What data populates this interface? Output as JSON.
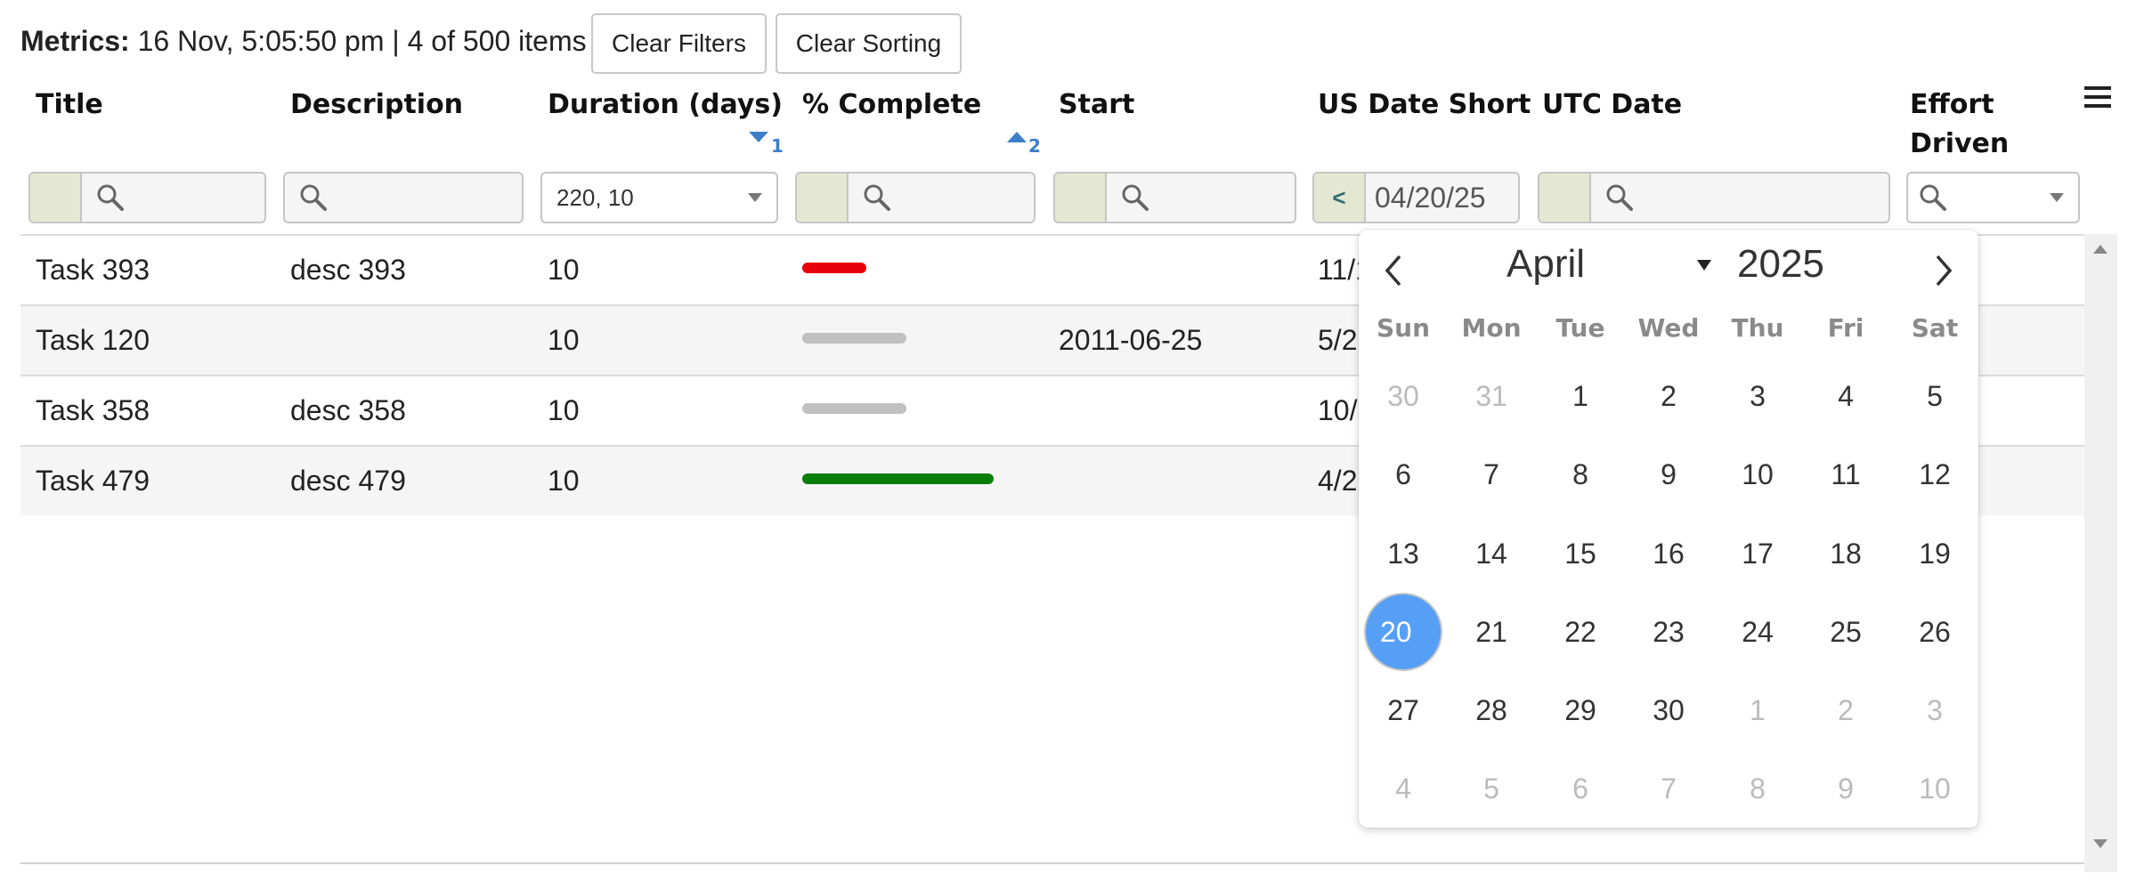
{
  "colors": {
    "accent": "#569ff7",
    "sort_indicator": "#3d7ec9",
    "filter_operator_bg": "#e4e8d2",
    "row_alt": "#f5f5f5",
    "bar_red": "#e8000b",
    "bar_gray": "#c0c0c0",
    "bar_green": "#0a7d0a"
  },
  "metrics": {
    "label": "Metrics:",
    "text": " 16 Nov, 5:05:50 pm | 4 of 500 items"
  },
  "toolbar": {
    "clear_filters": "Clear Filters",
    "clear_sorting": "Clear Sorting"
  },
  "grid_menu_icon": "hamburger-icon",
  "columns": [
    {
      "label": "Title"
    },
    {
      "label": "Description"
    },
    {
      "label": "Duration (days)",
      "sort": "desc",
      "sort_order": "1"
    },
    {
      "label": "% Complete",
      "sort": "asc",
      "sort_order": "2"
    },
    {
      "label": "Start"
    },
    {
      "label": "US Date Short"
    },
    {
      "label": "UTC Date"
    },
    {
      "label": "Effort Driven",
      "label_line1": "Effort",
      "label_line2": "Driven"
    }
  ],
  "filters": {
    "duration_selected": "220, 10",
    "us_date_operator": "<",
    "us_date_value": "04/20/25",
    "search_icon": "search-icon"
  },
  "rows": [
    {
      "title": "Task 393",
      "description": "desc 393",
      "duration": "10",
      "percent": 11,
      "bar": "red",
      "start": "",
      "us_date": "11/1"
    },
    {
      "title": "Task 120",
      "description": "",
      "duration": "10",
      "percent": 18,
      "bar": "gray",
      "start": "2011-06-25",
      "us_date": "5/2"
    },
    {
      "title": "Task 358",
      "description": "desc 358",
      "duration": "10",
      "percent": 18,
      "bar": "gray",
      "start": "",
      "us_date": "10/"
    },
    {
      "title": "Task 479",
      "description": "desc 479",
      "duration": "10",
      "percent": 33,
      "bar": "green",
      "start": "",
      "us_date": "4/2"
    }
  ],
  "calendar": {
    "month": "April",
    "year": "2025",
    "weekdays": [
      "Sun",
      "Mon",
      "Tue",
      "Wed",
      "Thu",
      "Fri",
      "Sat"
    ],
    "weeks": [
      [
        {
          "d": "30",
          "out": true
        },
        {
          "d": "31",
          "out": true
        },
        {
          "d": "1"
        },
        {
          "d": "2"
        },
        {
          "d": "3"
        },
        {
          "d": "4"
        },
        {
          "d": "5"
        }
      ],
      [
        {
          "d": "6"
        },
        {
          "d": "7"
        },
        {
          "d": "8"
        },
        {
          "d": "9"
        },
        {
          "d": "10"
        },
        {
          "d": "11"
        },
        {
          "d": "12"
        }
      ],
      [
        {
          "d": "13"
        },
        {
          "d": "14"
        },
        {
          "d": "15"
        },
        {
          "d": "16"
        },
        {
          "d": "17"
        },
        {
          "d": "18"
        },
        {
          "d": "19"
        }
      ],
      [
        {
          "d": "20",
          "selected": true
        },
        {
          "d": "21"
        },
        {
          "d": "22"
        },
        {
          "d": "23"
        },
        {
          "d": "24"
        },
        {
          "d": "25"
        },
        {
          "d": "26"
        }
      ],
      [
        {
          "d": "27"
        },
        {
          "d": "28"
        },
        {
          "d": "29"
        },
        {
          "d": "30"
        },
        {
          "d": "1",
          "out": true
        },
        {
          "d": "2",
          "out": true
        },
        {
          "d": "3",
          "out": true
        }
      ],
      [
        {
          "d": "4",
          "out": true
        },
        {
          "d": "5",
          "out": true
        },
        {
          "d": "6",
          "out": true
        },
        {
          "d": "7",
          "out": true
        },
        {
          "d": "8",
          "out": true
        },
        {
          "d": "9",
          "out": true
        },
        {
          "d": "10",
          "out": true
        }
      ]
    ]
  }
}
